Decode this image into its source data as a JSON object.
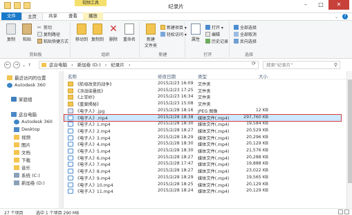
{
  "window": {
    "title": "纪录片",
    "context_tab_label": "视频工具",
    "controls": {
      "minimize": "–",
      "maximize": "□",
      "close": "✕"
    },
    "help": "?"
  },
  "tabs": [
    "文件",
    "主页",
    "共享",
    "查看",
    "播放"
  ],
  "ribbon": {
    "clipboard": {
      "label": "剪贴板",
      "copy": "复制",
      "paste": "粘贴",
      "cut": "剪切",
      "copy_path": "复制路径",
      "paste_shortcut": "粘贴快捷方式"
    },
    "organize": {
      "label": "组织",
      "move_to": "移动到",
      "copy_to": "复制到",
      "delete": "删除",
      "rename": "重命名"
    },
    "new": {
      "label": "新建",
      "new_folder": "新建\n文件夹",
      "new_item": "新建项目 ▾",
      "easy_access": "轻松访问 ▾"
    },
    "open": {
      "label": "打开",
      "properties": "属性",
      "open": "打开 ▾",
      "edit": "编辑",
      "history": "历史记录"
    },
    "select": {
      "label": "选择",
      "select_all": "全部选择",
      "select_none": "全部取消",
      "invert": "反向选择"
    }
  },
  "address": {
    "crumbs": [
      "这台电脑",
      "›",
      "新加卷 (D:)",
      "›",
      "纪录片",
      "›"
    ],
    "search_placeholder": "搜索\"纪录片\""
  },
  "navpane": [
    {
      "label": "最近访问的位置",
      "icon": "recent-icon"
    },
    {
      "label": "Autodesk 360",
      "icon": "cloud-icon"
    },
    {
      "label": "家庭组",
      "icon": "homegroup-icon"
    },
    {
      "label": "这台电脑",
      "icon": "pc-icon"
    },
    {
      "label": "Autodesk 360",
      "icon": "cloud-icon"
    },
    {
      "label": "Desktop",
      "icon": "desktop-icon"
    },
    {
      "label": "视频",
      "icon": "video-folder-icon"
    },
    {
      "label": "图片",
      "icon": "pictures-folder-icon"
    },
    {
      "label": "文档",
      "icon": "documents-folder-icon"
    },
    {
      "label": "下载",
      "icon": "downloads-folder-icon"
    },
    {
      "label": "音乐",
      "icon": "music-folder-icon"
    },
    {
      "label": "系统 (C:)",
      "icon": "drive-icon"
    },
    {
      "label": "新加卷 (D:)",
      "icon": "drive-icon"
    }
  ],
  "columns": {
    "name": "名称",
    "date": "修改日期",
    "type": "类型",
    "size": "大小"
  },
  "files": [
    {
      "name": "《航母改变的战争》",
      "date": "2015/2/23 16:09",
      "type": "文件夹",
      "size": "",
      "kind": "folder"
    },
    {
      "name": "《决战诺曼底》",
      "date": "2015/2/23 17:25",
      "type": "文件夹",
      "size": "",
      "kind": "folder"
    },
    {
      "name": "《上甘岭》",
      "date": "2015/2/23 16:34",
      "type": "文件夹",
      "size": "",
      "kind": "folder"
    },
    {
      "name": "《重案揭秘》",
      "date": "2015/2/23 15:08",
      "type": "文件夹",
      "size": "",
      "kind": "folder"
    },
    {
      "name": "《电子人》.jpg",
      "date": "2015/2/28 18:16",
      "type": "JPEG 图像",
      "size": "12 KB",
      "kind": "jpg"
    },
    {
      "name": "《电子人》.mp4",
      "date": "2015/2/28 18:38",
      "type": "媒体文件(.mp4)",
      "size": "297,760 KB",
      "kind": "media",
      "selected": true
    },
    {
      "name": "《电子人》1.mp4",
      "date": "2015/2/28 18:30",
      "type": "媒体文件(.mp4)",
      "size": "19,584 KB",
      "kind": "media"
    },
    {
      "name": "《电子人》2.mp4",
      "date": "2015/2/28 18:27",
      "type": "媒体文件(.mp4)",
      "size": "20,529 KB",
      "kind": "media"
    },
    {
      "name": "《电子人》3.mp4",
      "date": "2015/2/28 18:29",
      "type": "媒体文件(.mp4)",
      "size": "20,296 KB",
      "kind": "media"
    },
    {
      "name": "《电子人》4.mp4",
      "date": "2015/2/28 18:30",
      "type": "媒体文件(.mp4)",
      "size": "20,129 KB",
      "kind": "media"
    },
    {
      "name": "《电子人》5.mp4",
      "date": "2015/2/28 18:30",
      "type": "媒体文件(.mp4)",
      "size": "21,576 KB",
      "kind": "media"
    },
    {
      "name": "《电子人》6.mp4",
      "date": "2015/2/28 18:27",
      "type": "媒体文件(.mp4)",
      "size": "20,288 KB",
      "kind": "media"
    },
    {
      "name": "《电子人》7.mp4",
      "date": "2015/2/28 17:47",
      "type": "媒体文件(.mp4)",
      "size": "19,888 KB",
      "kind": "media"
    },
    {
      "name": "《电子人》8.mp4",
      "date": "2015/2/28 18:27",
      "type": "媒体文件(.mp4)",
      "size": "23,022 KB",
      "kind": "media"
    },
    {
      "name": "《电子人》9.mp4",
      "date": "2015/2/28 18:29",
      "type": "媒体文件(.mp4)",
      "size": "19,565 KB",
      "kind": "media"
    },
    {
      "name": "《电子人》10.mp4",
      "date": "2015/2/28 18:25",
      "type": "媒体文件(.mp4)",
      "size": "20,129 KB",
      "kind": "media"
    },
    {
      "name": "《电子人》11.mp4",
      "date": "2015/2/28 18:24",
      "type": "媒体文件(.mp4)",
      "size": "20,129 KB",
      "kind": "media"
    }
  ],
  "status": {
    "count": "27 个项目",
    "selection": "选中 1 个项目 290 MB"
  },
  "colors": {
    "accent": "#1979ca",
    "selection": "#cde8ff",
    "highlight": "#d63b3b",
    "folder": "#f3c44f"
  }
}
